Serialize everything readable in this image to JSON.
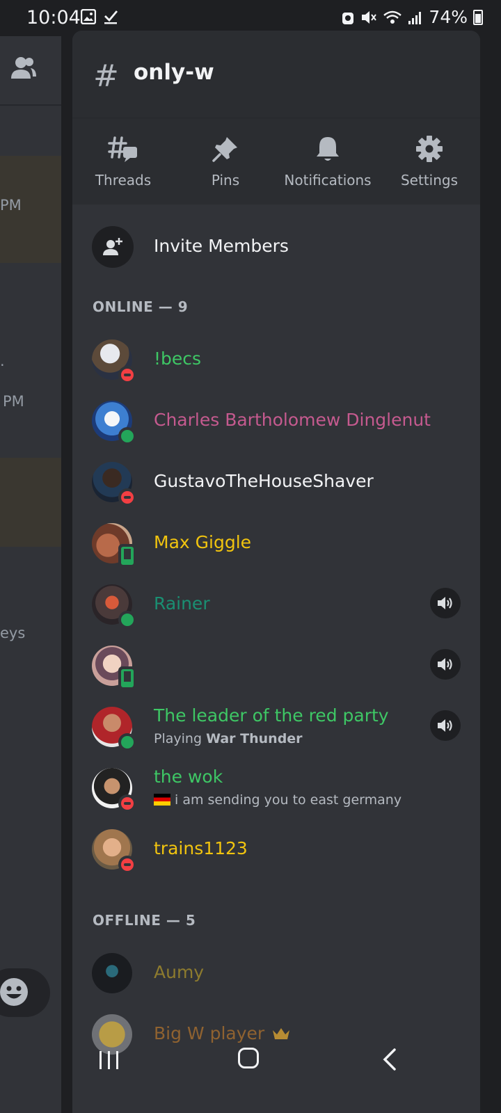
{
  "status_bar": {
    "time": "10:04",
    "left_icons": [
      "image-icon",
      "check-download-icon"
    ],
    "right_icons": [
      "alarm-icon",
      "mute-icon",
      "wifi-icon",
      "signal-icon"
    ],
    "battery": "74%"
  },
  "background_chat": {
    "snippets": [
      "PM",
      ".",
      "PM",
      "eys"
    ]
  },
  "channel": {
    "name": "only-w",
    "hash_symbol": "#"
  },
  "toolbar": [
    {
      "label": "Threads",
      "icon": "threads-icon"
    },
    {
      "label": "Pins",
      "icon": "pin-icon"
    },
    {
      "label": "Notifications",
      "icon": "bell-icon"
    },
    {
      "label": "Settings",
      "icon": "gear-icon"
    }
  ],
  "invite": {
    "label": "Invite Members"
  },
  "online_section": {
    "title": "ONLINE — 9"
  },
  "offline_section": {
    "title": "OFFLINE — 5"
  },
  "members_online": [
    {
      "name": "!becs",
      "color": "#3ec765",
      "status": "dnd"
    },
    {
      "name": "Charles Bartholomew Dinglenut",
      "color": "#c55a8f",
      "status": "online"
    },
    {
      "name": "GustavoTheHouseShaver",
      "color": "#f2f3f5",
      "status": "dnd"
    },
    {
      "name": "Max Giggle",
      "color": "#f1c40f",
      "status": "mobile"
    },
    {
      "name": "Rainer",
      "color": "#1a8f72",
      "status": "online",
      "voice": true
    },
    {
      "name": "",
      "color": "#2f4a2c",
      "status": "mobile",
      "voice": true
    },
    {
      "name": "The leader of the red party",
      "color": "#3ec765",
      "status": "online",
      "voice": true,
      "activity_prefix": "Playing",
      "activity_bold": "War Thunder"
    },
    {
      "name": "the wok",
      "color": "#3ec765",
      "status": "dnd",
      "custom_status": "i am sending you to east germany",
      "custom_status_emoji": "germany-flag-icon"
    },
    {
      "name": "trains1123",
      "color": "#f1c40f",
      "status": "dnd"
    }
  ],
  "members_offline": [
    {
      "name": "Aumy",
      "color": "#b59a2a"
    },
    {
      "name": "Big W player",
      "color": "#b8762d",
      "badge": "crown-icon"
    }
  ],
  "nav_bar": {
    "icons": [
      "recent-apps-icon",
      "home-icon",
      "back-icon"
    ]
  }
}
